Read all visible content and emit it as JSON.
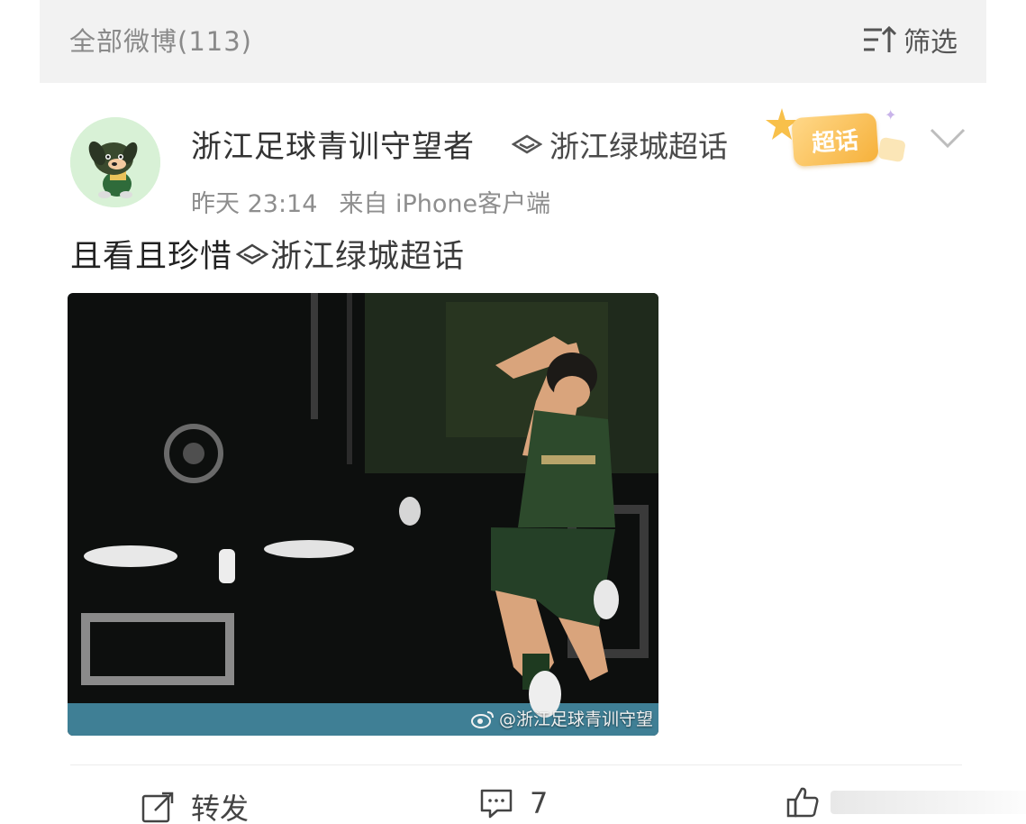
{
  "filter_bar": {
    "all_posts": "全部微博(113)",
    "filter_label": "筛选",
    "filter_icon": "filter-sort-icon"
  },
  "post": {
    "author": "浙江足球青训守望者",
    "topic_tag": "浙江绿城超话",
    "super_badge": "超话",
    "time": "昨天 23:14",
    "source": "来自 iPhone客户端",
    "text": "且看且珍惜",
    "text_topic": "浙江绿城超话",
    "image": {
      "alt_semantic": "football-player-celebration-photo",
      "watermark": "@浙江足球青训守望"
    },
    "actions": {
      "repost_label": "转发",
      "comment_count": "7",
      "like_label": ""
    }
  },
  "colors": {
    "filter_bg": "#f2f2f2",
    "badge_gold": "#f6b13b",
    "jersey_green": "#2d4a2c",
    "stadium_dark": "#0d0f0e",
    "photo_stripe": "#3f7f95"
  }
}
